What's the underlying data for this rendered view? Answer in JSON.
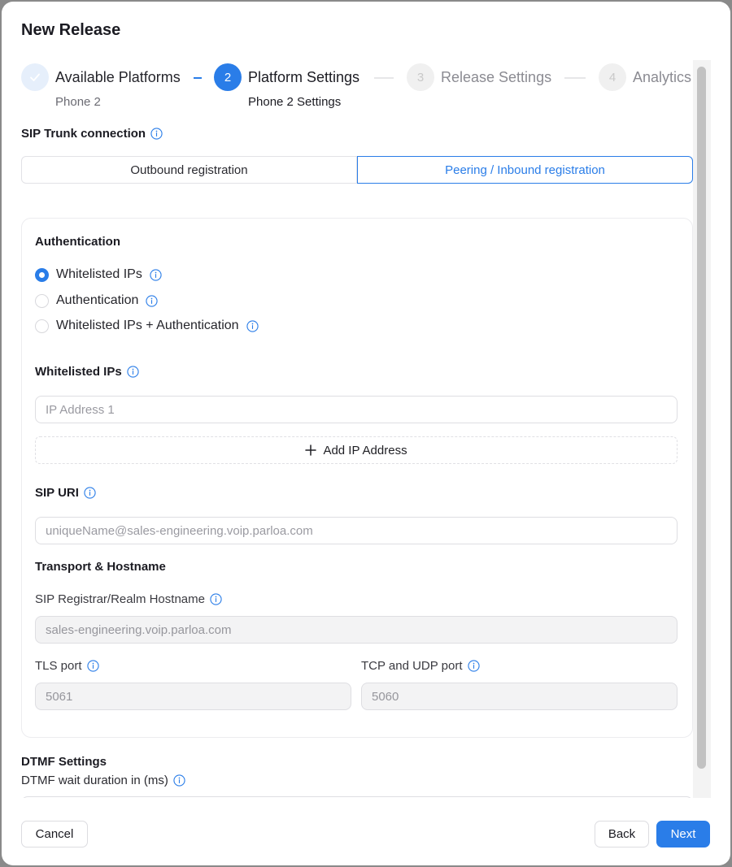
{
  "dialog": {
    "title": "New Release"
  },
  "stepper": {
    "steps": [
      {
        "number": "✓",
        "label": "Available Platforms",
        "sub": "Phone 2",
        "state": "done"
      },
      {
        "number": "2",
        "label": "Platform Settings",
        "sub": "Phone 2 Settings",
        "state": "active"
      },
      {
        "number": "3",
        "label": "Release Settings",
        "sub": "",
        "state": "todo"
      },
      {
        "number": "4",
        "label": "Analytics",
        "sub": "",
        "state": "todo"
      }
    ]
  },
  "sip_trunk": {
    "label": "SIP Trunk connection",
    "tabs": [
      {
        "label": "Outbound registration",
        "selected": false
      },
      {
        "label": "Peering / Inbound registration",
        "selected": true
      }
    ]
  },
  "authentication": {
    "heading": "Authentication",
    "options": [
      {
        "label": "Whitelisted IPs",
        "checked": true
      },
      {
        "label": "Authentication",
        "checked": false
      },
      {
        "label": "Whitelisted IPs + Authentication",
        "checked": false
      }
    ]
  },
  "whitelisted_ips": {
    "heading": "Whitelisted IPs",
    "ip1_placeholder": "IP Address 1",
    "add_label": "Add IP Address"
  },
  "sip_uri": {
    "heading": "SIP URI",
    "placeholder": "uniqueName@sales-engineering.voip.parloa.com"
  },
  "transport": {
    "heading": "Transport & Hostname",
    "registrar_label": "SIP Registrar/Realm Hostname",
    "registrar_value": "sales-engineering.voip.parloa.com",
    "tls_label": "TLS port",
    "tls_value": "5061",
    "tcp_udp_label": "TCP and UDP port",
    "tcp_udp_value": "5060"
  },
  "dtmf": {
    "heading": "DTMF Settings",
    "wait_label": "DTMF wait duration in (ms)"
  },
  "footer": {
    "cancel": "Cancel",
    "back": "Back",
    "next": "Next"
  },
  "colors": {
    "accent": "#2a7de8"
  }
}
